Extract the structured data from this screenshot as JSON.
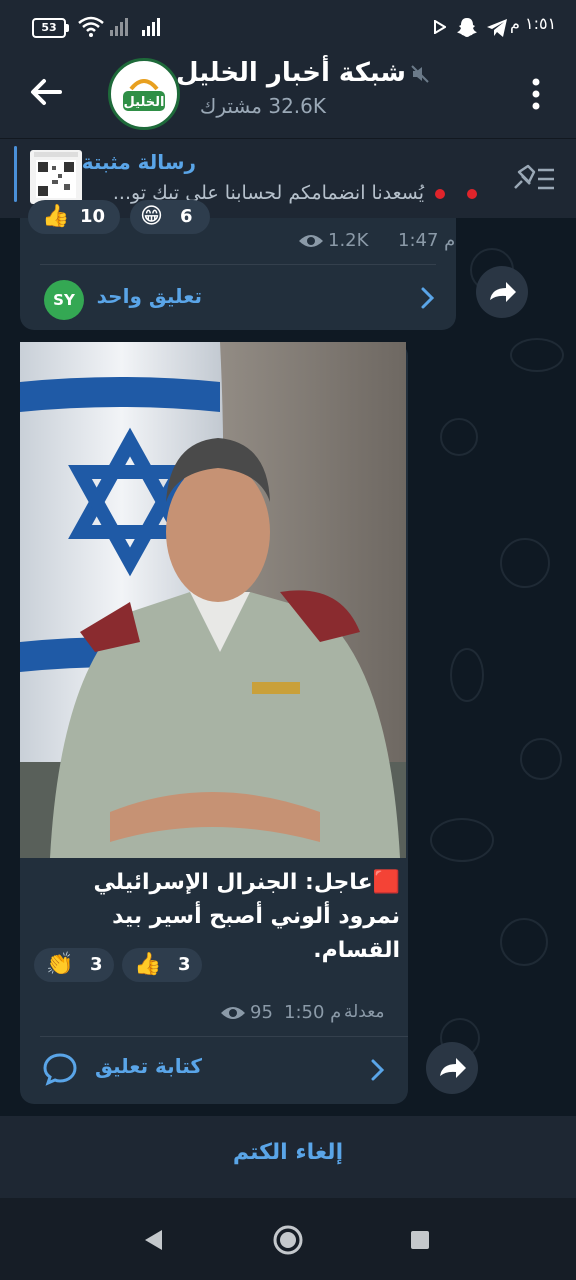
{
  "status_bar": {
    "battery": "53",
    "time": "١:٥١ م"
  },
  "header": {
    "channel_name": "شبكة أخبار الخليل",
    "subscribers": "32.6K مشترك",
    "avatar_text": "الخليل"
  },
  "pinned": {
    "label": "رسالة مثبتة",
    "text": "يُسعدنا انضمامكم لحسابنا على تيك تو..."
  },
  "post1": {
    "reactions": [
      {
        "emoji": "👍",
        "count": "10"
      },
      {
        "emoji": "😁",
        "count": "6"
      }
    ],
    "time": "1:47 م",
    "views": "1.2K",
    "comment_avatar": "SY",
    "comment_label": "تعليق واحد"
  },
  "post2": {
    "caption": "🟥عاجل: الجنرال الإسرائيلي نمرود ألوني أصبح أسير بيد القسام.",
    "reactions": [
      {
        "emoji": "👏",
        "count": "3"
      },
      {
        "emoji": "👍",
        "count": "3"
      }
    ],
    "edited": "معدلة",
    "time": "1:50 م",
    "views": "95",
    "comment_label": "كتابة تعليق"
  },
  "footer": {
    "unmute_label": "إلغاء الكتم"
  },
  "colors": {
    "accent": "#5aa5e8",
    "bubble": "#222f3c",
    "header": "#1e2733",
    "chat_bg": "#0f1923"
  }
}
